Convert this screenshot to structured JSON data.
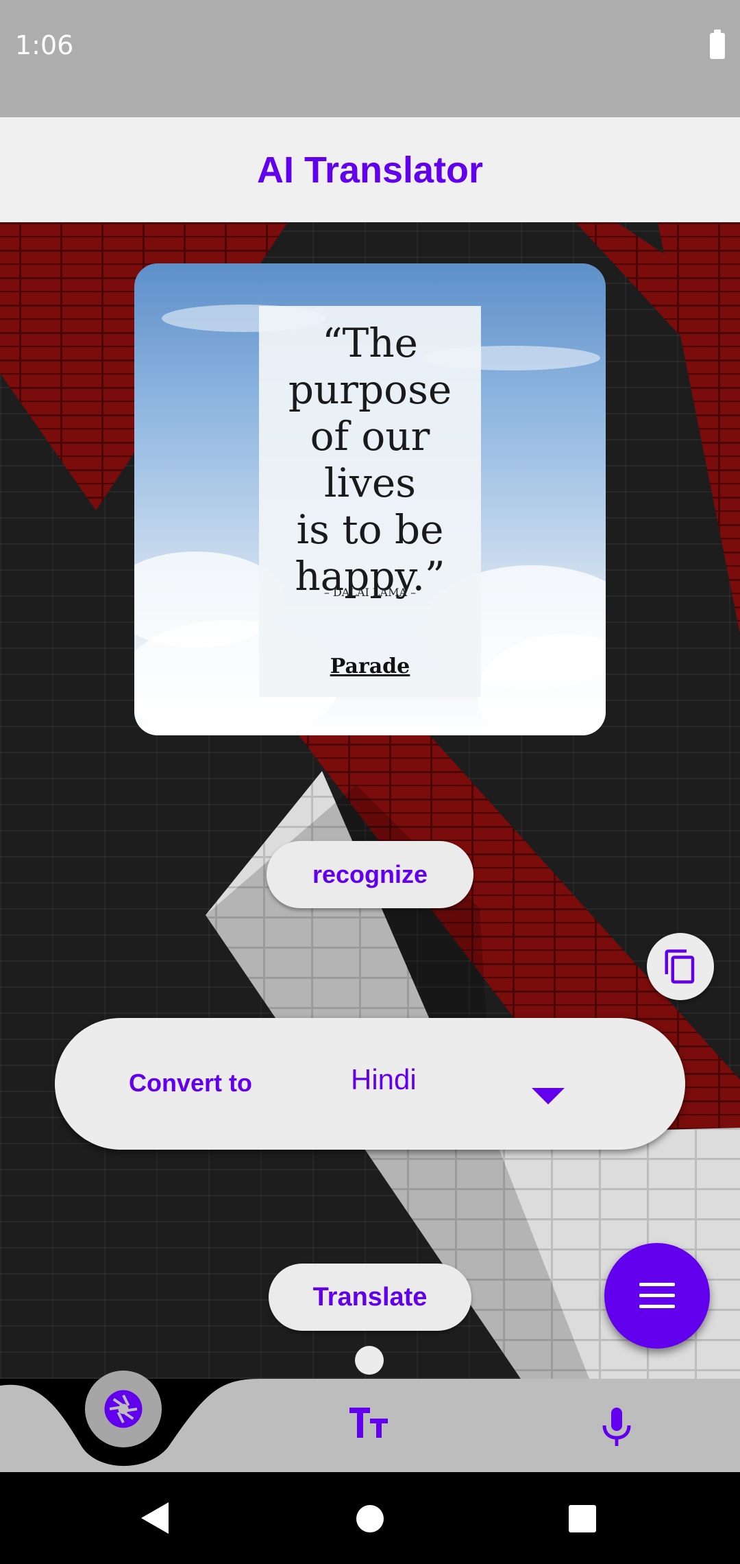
{
  "status_bar": {
    "time": "1:06",
    "battery_icon": "battery-full-icon"
  },
  "app_bar": {
    "title": "AI Translator"
  },
  "image_card": {
    "quote_text": "“The\npurpose\nof our lives\nis to be\nhappy.”",
    "quote_author": "– DALAI LAMA –",
    "quote_brand": "Parade"
  },
  "buttons": {
    "recognize": "recognize",
    "translate": "Translate"
  },
  "convert": {
    "label": "Convert to",
    "selected_language": "Hindi"
  },
  "icons": {
    "copy": "copy-icon",
    "menu": "menu-icon",
    "camera": "camera-shutter-icon",
    "text": "text-size-icon",
    "mic": "microphone-icon"
  },
  "colors": {
    "accent": "#6200ee",
    "app_bar": "#f0f0f0",
    "status_bar": "#adadad",
    "bottom_bar": "#bdbdbd"
  }
}
